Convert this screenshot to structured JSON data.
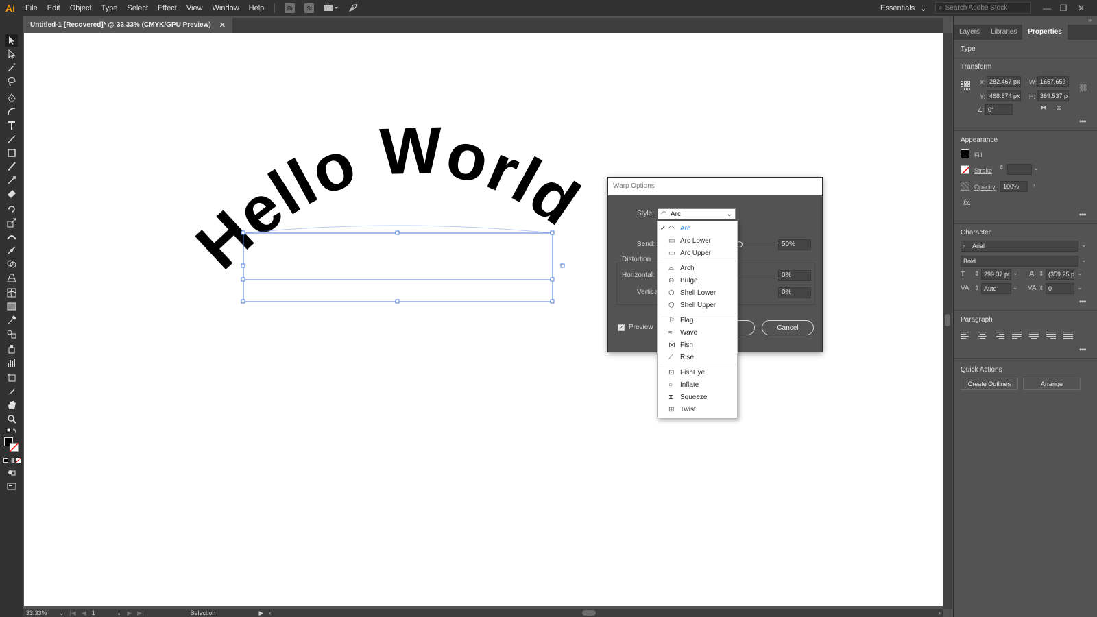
{
  "app": {
    "logo": "Ai"
  },
  "menubar": {
    "items": [
      "File",
      "Edit",
      "Object",
      "Type",
      "Select",
      "Effect",
      "View",
      "Window",
      "Help"
    ],
    "workspace": "Essentials",
    "search_placeholder": "Search Adobe Stock"
  },
  "document": {
    "tab_title": "Untitled-1 [Recovered]* @ 33.33% (CMYK/GPU Preview)"
  },
  "artwork": {
    "text": "Hello World"
  },
  "status": {
    "zoom": "33.33%",
    "artboard_num": "1",
    "tool": "Selection"
  },
  "panel": {
    "tabs": [
      "Layers",
      "Libraries",
      "Properties"
    ],
    "active_tab": "Properties",
    "type_label": "Type",
    "transform": {
      "title": "Transform",
      "x_label": "X:",
      "x": "282.467 px",
      "y_label": "Y:",
      "y": "468.874 px",
      "w_label": "W:",
      "w": "1657.653 p",
      "h_label": "H:",
      "h": "369.537 px",
      "angle": "0°"
    },
    "appearance": {
      "title": "Appearance",
      "fill": "Fill",
      "stroke": "Stroke",
      "opacity_label": "Opacity",
      "opacity": "100%",
      "fx": "fx."
    },
    "character": {
      "title": "Character",
      "font": "Arial",
      "style": "Bold",
      "size": "299.37 pt",
      "leading": "(359.25 p",
      "tracking": "Auto",
      "kerning": "0"
    },
    "paragraph": {
      "title": "Paragraph"
    },
    "quick_actions": {
      "title": "Quick Actions",
      "create_outlines": "Create Outlines",
      "arrange": "Arrange"
    }
  },
  "warp_dialog": {
    "title": "Warp Options",
    "style_label": "Style:",
    "style_value": "Arc",
    "bend_label": "Bend:",
    "bend_value": "50%",
    "distortion_label": "Distortion",
    "horizontal_label": "Horizontal:",
    "horizontal_value": "0%",
    "vertical_label": "Vertical:",
    "vertical_value": "0%",
    "preview_label": "Preview",
    "preview_checked": true,
    "cancel_label": "Cancel"
  },
  "style_menu": {
    "groups": [
      [
        {
          "label": "Arc",
          "icon": "arc-icon",
          "selected": true
        },
        {
          "label": "Arc Lower",
          "icon": "arc-lower-icon"
        },
        {
          "label": "Arc Upper",
          "icon": "arc-upper-icon"
        }
      ],
      [
        {
          "label": "Arch",
          "icon": "arch-icon"
        },
        {
          "label": "Bulge",
          "icon": "bulge-icon"
        },
        {
          "label": "Shell Lower",
          "icon": "shell-lower-icon"
        },
        {
          "label": "Shell Upper",
          "icon": "shell-upper-icon"
        }
      ],
      [
        {
          "label": "Flag",
          "icon": "flag-icon"
        },
        {
          "label": "Wave",
          "icon": "wave-icon"
        },
        {
          "label": "Fish",
          "icon": "fish-icon"
        },
        {
          "label": "Rise",
          "icon": "rise-icon"
        }
      ],
      [
        {
          "label": "FishEye",
          "icon": "fisheye-icon"
        },
        {
          "label": "Inflate",
          "icon": "inflate-icon"
        },
        {
          "label": "Squeeze",
          "icon": "squeeze-icon"
        },
        {
          "label": "Twist",
          "icon": "twist-icon"
        }
      ]
    ]
  },
  "colors": {
    "accent": "#2d8ceb",
    "selection": "#4a7bd8",
    "logo": "#ff9a00"
  }
}
